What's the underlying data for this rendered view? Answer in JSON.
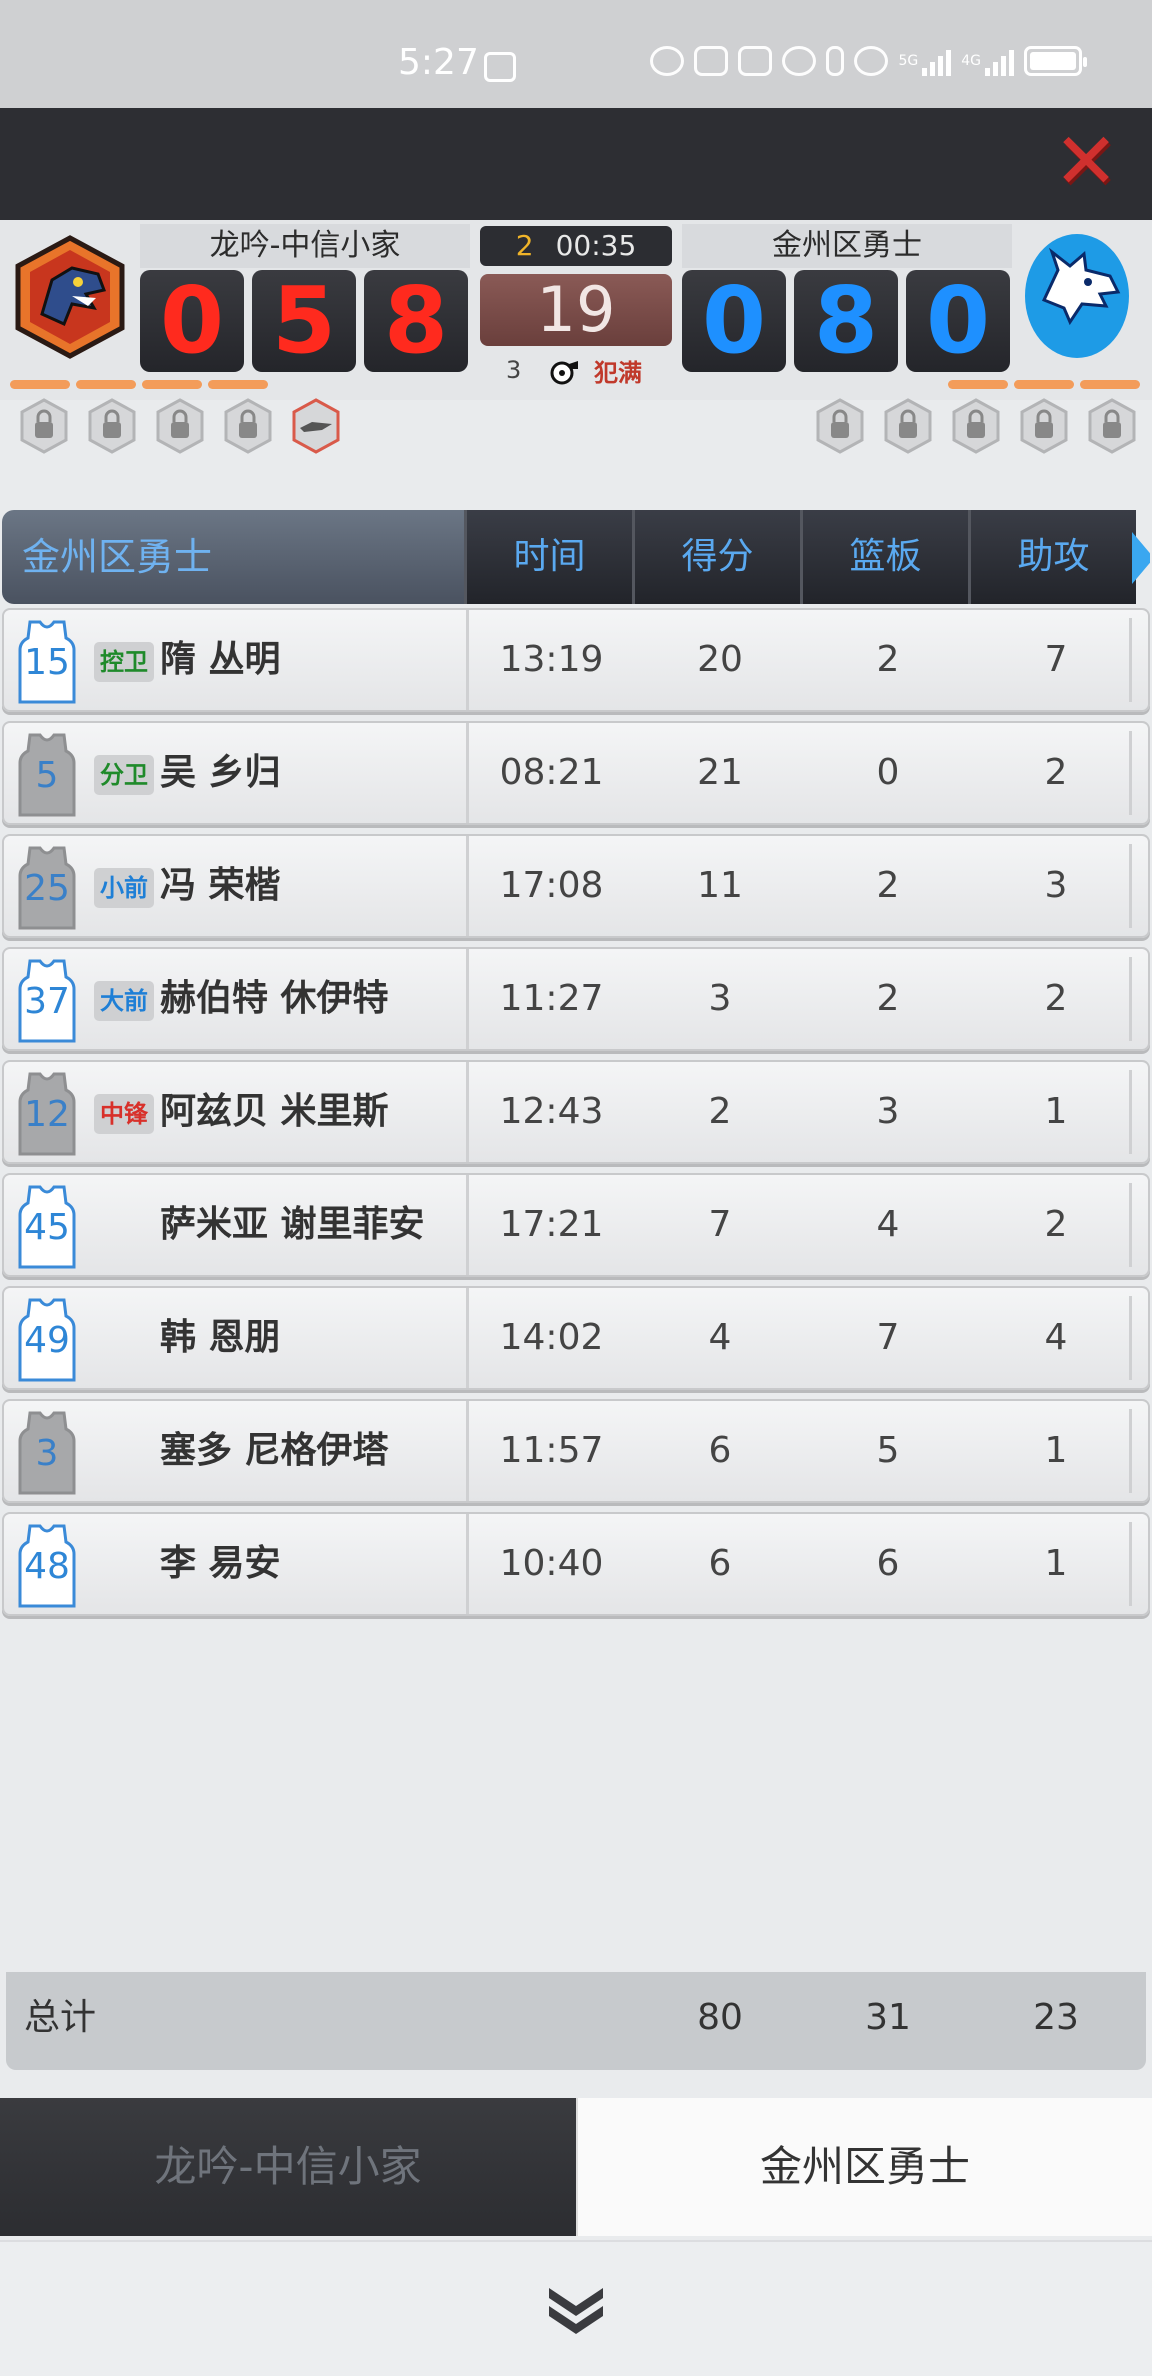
{
  "status_bar": {
    "time": "5:27",
    "network1": "5G",
    "network2": "4G"
  },
  "colors": {
    "home_score": "#ff2a1e",
    "away_score": "#1e90ff",
    "accent_blue": "#5aa9f0",
    "close_red": "#d0302e"
  },
  "scoreboard": {
    "home_team": "龙吟-中信小家",
    "away_team": "金州区勇士",
    "home_score_digits": [
      "0",
      "5",
      "8"
    ],
    "away_score_digits": [
      "0",
      "8",
      "0"
    ],
    "quarter": "2",
    "game_clock": "00:35",
    "shot_clock": "19",
    "team_fouls": "3",
    "fouls_status": "犯满",
    "home_timeouts_remaining": 4,
    "away_timeouts_remaining": 3
  },
  "table": {
    "team_header": "金州区勇士",
    "columns": [
      "时间",
      "得分",
      "篮板",
      "助攻"
    ],
    "players": [
      {
        "number": "15",
        "jersey": "white",
        "position": "控卫",
        "pos_color": "green",
        "name": "隋 丛明",
        "time": "13:19",
        "points": "20",
        "rebounds": "2",
        "assists": "7"
      },
      {
        "number": "5",
        "jersey": "gray",
        "position": "分卫",
        "pos_color": "green",
        "name": "吴 乡归",
        "time": "08:21",
        "points": "21",
        "rebounds": "0",
        "assists": "2"
      },
      {
        "number": "25",
        "jersey": "gray",
        "position": "小前",
        "pos_color": "blue",
        "name": "冯 荣楷",
        "time": "17:08",
        "points": "11",
        "rebounds": "2",
        "assists": "3"
      },
      {
        "number": "37",
        "jersey": "white",
        "position": "大前",
        "pos_color": "blue",
        "name": "赫伯特 休伊特",
        "time": "11:27",
        "points": "3",
        "rebounds": "2",
        "assists": "2"
      },
      {
        "number": "12",
        "jersey": "gray",
        "position": "中锋",
        "pos_color": "red",
        "name": "阿兹贝 米里斯",
        "time": "12:43",
        "points": "2",
        "rebounds": "3",
        "assists": "1"
      },
      {
        "number": "45",
        "jersey": "white",
        "position": "",
        "pos_color": "",
        "name": "萨米亚 谢里菲安",
        "time": "17:21",
        "points": "7",
        "rebounds": "4",
        "assists": "2"
      },
      {
        "number": "49",
        "jersey": "white",
        "position": "",
        "pos_color": "",
        "name": "韩 恩朋",
        "time": "14:02",
        "points": "4",
        "rebounds": "7",
        "assists": "4"
      },
      {
        "number": "3",
        "jersey": "gray",
        "position": "",
        "pos_color": "",
        "name": "塞多 尼格伊塔",
        "time": "11:57",
        "points": "6",
        "rebounds": "5",
        "assists": "1"
      },
      {
        "number": "48",
        "jersey": "white",
        "position": "",
        "pos_color": "",
        "name": "李 易安",
        "time": "10:40",
        "points": "6",
        "rebounds": "6",
        "assists": "1"
      }
    ]
  },
  "totals": {
    "label": "总计",
    "points": "80",
    "rebounds": "31",
    "assists": "23"
  },
  "tabs": {
    "home": "龙吟-中信小家",
    "away": "金州区勇士"
  }
}
